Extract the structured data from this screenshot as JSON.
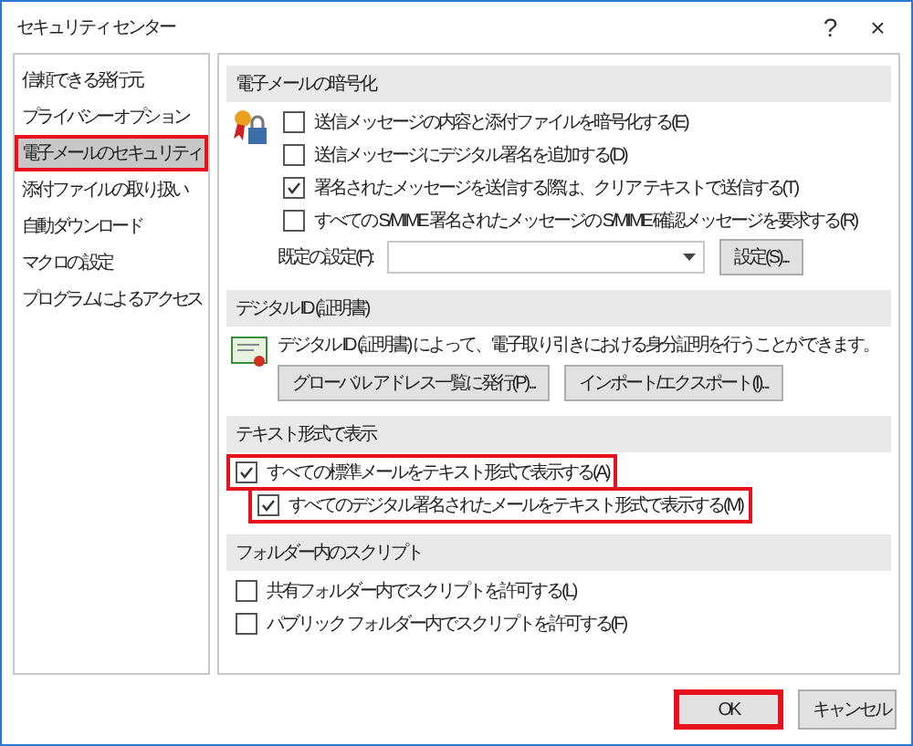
{
  "window": {
    "title": "セキュリティ センター",
    "help": "?",
    "close": "×"
  },
  "sidebar": {
    "items": [
      {
        "label": "信頼できる発行元",
        "selected": false,
        "highlighted": false
      },
      {
        "label": "プライバシー オプション",
        "selected": false,
        "highlighted": false
      },
      {
        "label": "電子メールのセキュリティ",
        "selected": true,
        "highlighted": true
      },
      {
        "label": "添付ファイルの取り扱い",
        "selected": false,
        "highlighted": false
      },
      {
        "label": "自動ダウンロード",
        "selected": false,
        "highlighted": false
      },
      {
        "label": "マクロの設定",
        "selected": false,
        "highlighted": false
      },
      {
        "label": "プログラムによるアクセス",
        "selected": false,
        "highlighted": false
      }
    ]
  },
  "sections": [
    {
      "title": "電子メールの暗号化",
      "kind": "encryption",
      "rows": [
        {
          "kind": "checkbox",
          "label": "送信メッセージの内容と添付ファイルを暗号化する(E)",
          "checked": false,
          "highlighted": false
        },
        {
          "kind": "checkbox",
          "label": "送信メッセージにデジタル署名を追加する(D)",
          "checked": false,
          "highlighted": false
        },
        {
          "kind": "checkbox",
          "label": "署名されたメッセージを送信する際は、クリア テキストで送信する(T)",
          "checked": true,
          "highlighted": false
        },
        {
          "kind": "checkbox",
          "label": "すべての S/MIME 署名されたメッセージの S/MIME 確認メッセージを要求する(R)",
          "checked": false,
          "highlighted": false
        },
        {
          "kind": "dropdown",
          "label": "既定の設定(F):",
          "button": "設定(S)..."
        }
      ]
    },
    {
      "title": "デジタル ID (証明書)",
      "kind": "certificate",
      "rows": [
        {
          "kind": "text",
          "label": "デジタル ID (証明書) によって、電子取り引きにおける身分証明を行うことができます。"
        },
        {
          "kind": "buttons",
          "buttons": [
            "グローバル アドレス一覧に発行(P)...",
            "インポート/エクスポート(I)..."
          ]
        }
      ]
    },
    {
      "title": "テキスト形式で表示",
      "kind": "plain",
      "rows": [
        {
          "kind": "checkbox",
          "label": "すべての標準メールをテキスト形式で表示する(A)",
          "checked": true,
          "highlighted": true,
          "children": [
            {
              "kind": "checkbox",
              "label": "すべてのデジタル署名されたメールをテキスト形式で表示する(M)",
              "checked": true,
              "highlighted": true
            }
          ]
        }
      ]
    },
    {
      "title": "フォルダー内のスクリプト",
      "kind": "plain",
      "rows": [
        {
          "kind": "checkbox",
          "label": "共有フォルダー内でスクリプトを許可する(L)",
          "checked": false,
          "highlighted": false
        },
        {
          "kind": "checkbox",
          "label": "パブリック フォルダー内でスクリプトを許可する(F)",
          "checked": false,
          "highlighted": false
        }
      ]
    }
  ],
  "footer": {
    "buttons": [
      {
        "label": "OK",
        "highlighted": true
      },
      {
        "label": "キャンセル",
        "highlighted": false
      }
    ]
  }
}
